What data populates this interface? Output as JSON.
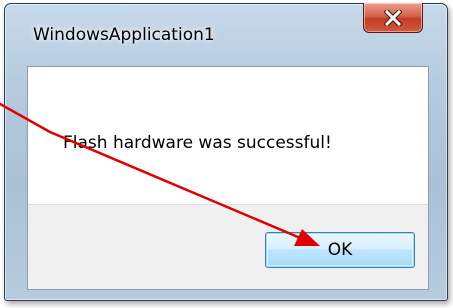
{
  "window": {
    "title": "WindowsApplication1"
  },
  "dialog": {
    "message": "Flash hardware was successful!",
    "ok_label": "OK"
  },
  "colors": {
    "annotation_arrow": "#e00000",
    "ok_button_border": "#3c7fb1",
    "close_button": "#c13d24"
  },
  "icons": {
    "close": "close-icon",
    "arrow": "arrow-annotation"
  }
}
